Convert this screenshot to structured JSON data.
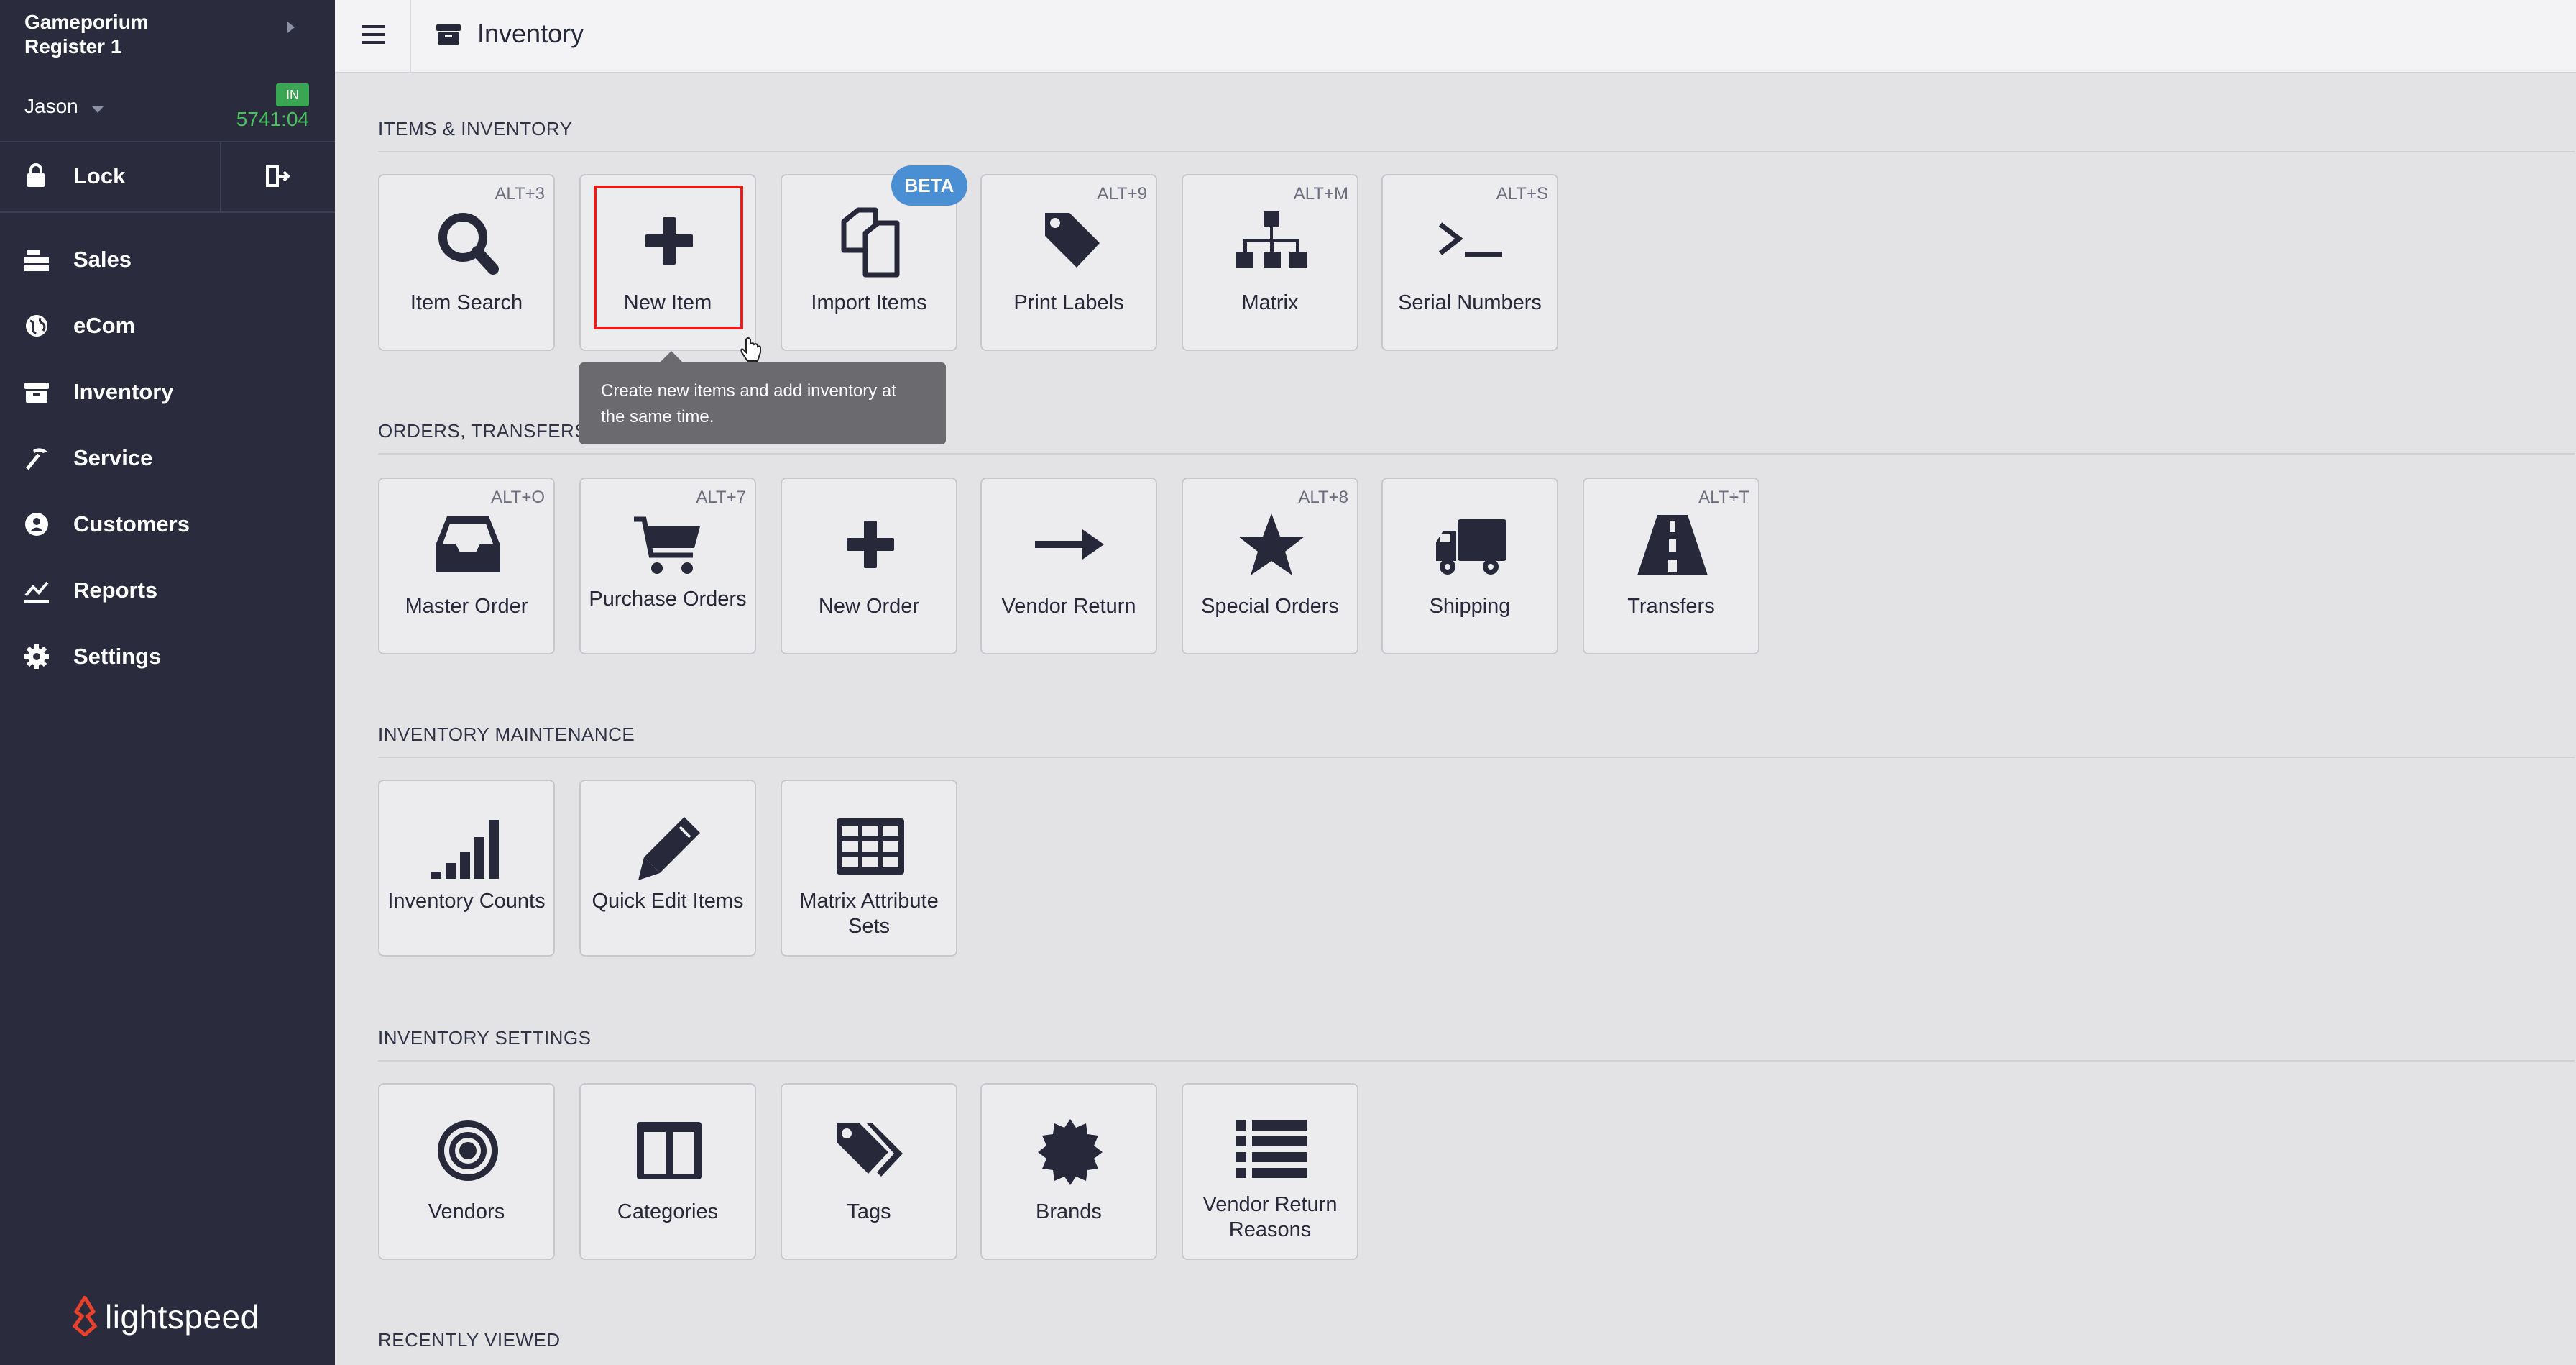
{
  "sidebar": {
    "store_name": "Gameporium",
    "register": "Register 1",
    "user": "Jason",
    "clock_badge": "IN",
    "clock_time": "5741:04",
    "lock_label": "Lock",
    "nav": [
      {
        "label": "Sales",
        "icon": "sales-icon"
      },
      {
        "label": "eCom",
        "icon": "globe-icon"
      },
      {
        "label": "Inventory",
        "icon": "inventory-box-icon"
      },
      {
        "label": "Service",
        "icon": "wrench-icon"
      },
      {
        "label": "Customers",
        "icon": "user-icon"
      },
      {
        "label": "Reports",
        "icon": "chart-line-icon"
      },
      {
        "label": "Settings",
        "icon": "gear-icon"
      }
    ],
    "logo_text": "lightspeed"
  },
  "header": {
    "title": "Inventory"
  },
  "sections": {
    "items": {
      "title": "ITEMS & INVENTORY",
      "tiles": [
        {
          "label": "Item Search",
          "shortcut": "ALT+3",
          "icon": "search-icon"
        },
        {
          "label": "New Item",
          "shortcut": "",
          "icon": "plus-icon"
        },
        {
          "label": "Import Items",
          "shortcut": "",
          "icon": "copy-icon",
          "badge": "BETA"
        },
        {
          "label": "Print Labels",
          "shortcut": "ALT+9",
          "icon": "tag-icon"
        },
        {
          "label": "Matrix",
          "shortcut": "ALT+M",
          "icon": "sitemap-icon"
        },
        {
          "label": "Serial Numbers",
          "shortcut": "ALT+S",
          "icon": "terminal-icon"
        }
      ]
    },
    "orders": {
      "title": "ORDERS, TRANSFERS,",
      "tiles": [
        {
          "label": "Master Order",
          "shortcut": "ALT+O",
          "icon": "inbox-icon"
        },
        {
          "label": "Purchase Orders",
          "shortcut": "ALT+7",
          "icon": "cart-icon"
        },
        {
          "label": "New Order",
          "shortcut": "",
          "icon": "plus-icon"
        },
        {
          "label": "Vendor Return",
          "shortcut": "",
          "icon": "arrow-right-icon"
        },
        {
          "label": "Special Orders",
          "shortcut": "ALT+8",
          "icon": "star-icon"
        },
        {
          "label": "Shipping",
          "shortcut": "",
          "icon": "truck-icon"
        },
        {
          "label": "Transfers",
          "shortcut": "ALT+T",
          "icon": "road-icon"
        }
      ]
    },
    "maintenance": {
      "title": "INVENTORY MAINTENANCE",
      "tiles": [
        {
          "label": "Inventory Counts",
          "icon": "signal-bars-icon"
        },
        {
          "label": "Quick Edit Items",
          "icon": "pencil-icon"
        },
        {
          "label": "Matrix Attribute Sets",
          "icon": "table-grid-icon"
        }
      ]
    },
    "settings": {
      "title": "INVENTORY SETTINGS",
      "tiles": [
        {
          "label": "Vendors",
          "icon": "target-icon"
        },
        {
          "label": "Categories",
          "icon": "columns-icon"
        },
        {
          "label": "Tags",
          "icon": "tags-icon"
        },
        {
          "label": "Brands",
          "icon": "badge-seal-icon"
        },
        {
          "label": "Vendor Return Reasons",
          "icon": "list-icon"
        }
      ]
    },
    "recent": {
      "title": "RECENTLY VIEWED"
    }
  },
  "tooltip": {
    "text": "Create new items and add inventory at the same time."
  },
  "colors": {
    "sidebar_bg": "#2a2c3e",
    "content_bg": "#e3e3e6",
    "clock_green": "#47c15c",
    "beta_blue": "#4a8fd4",
    "highlight_red": "#e02020",
    "logo_red": "#e8412c"
  }
}
